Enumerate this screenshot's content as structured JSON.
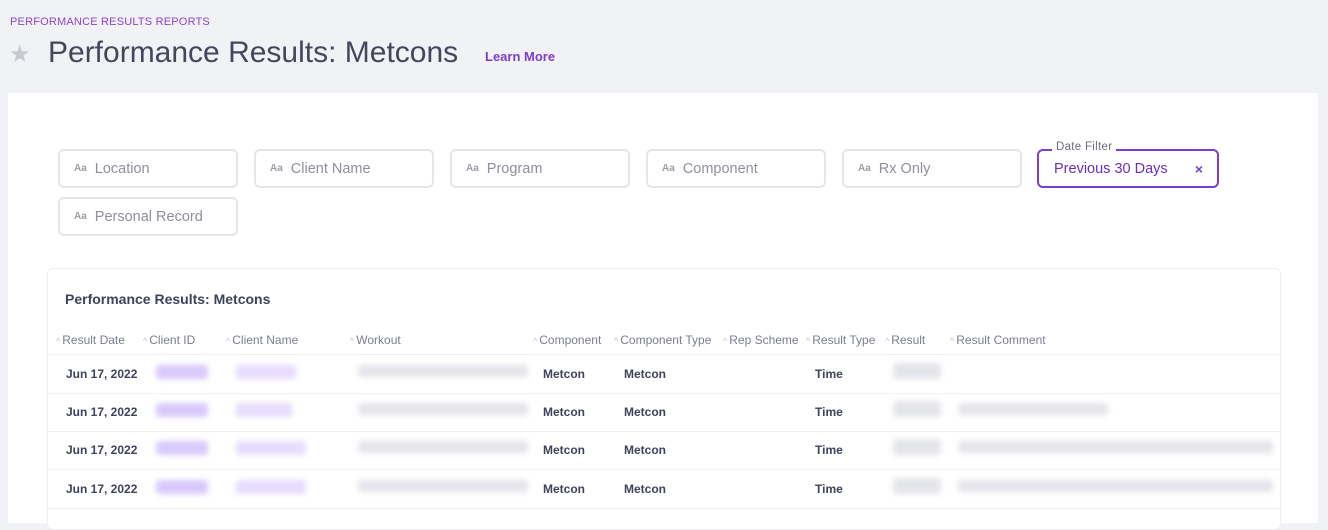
{
  "breadcrumb": "PERFORMANCE RESULTS REPORTS",
  "page_title": "Performance Results: Metcons",
  "learn_more": "Learn More",
  "filters": [
    {
      "icon_text": "Aa",
      "label": "Location"
    },
    {
      "icon_text": "Aa",
      "label": "Client Name"
    },
    {
      "icon_text": "Aa",
      "label": "Program"
    },
    {
      "icon_text": "Aa",
      "label": "Component"
    },
    {
      "icon_text": "Aa",
      "label": "Rx Only"
    },
    {
      "icon_text": "Aa",
      "label": "Personal Record"
    }
  ],
  "date_filter": {
    "label": "Date Filter",
    "value": "Previous 30 Days",
    "clear": "×"
  },
  "table": {
    "title": "Performance Results: Metcons",
    "columns": [
      "Result Date",
      "Client ID",
      "Client Name",
      "Workout",
      "Component",
      "Component Type",
      "Rep Scheme",
      "Result Type",
      "Result",
      "Result Comment"
    ],
    "rows": [
      {
        "date": "Jun 17, 2022",
        "component": "Metcon",
        "component_type": "Metcon",
        "result_type": "Time"
      },
      {
        "date": "Jun 17, 2022",
        "component": "Metcon",
        "component_type": "Metcon",
        "result_type": "Time"
      },
      {
        "date": "Jun 17, 2022",
        "component": "Metcon",
        "component_type": "Metcon",
        "result_type": "Time"
      },
      {
        "date": "Jun 17, 2022",
        "component": "Metcon",
        "component_type": "Metcon",
        "result_type": "Time"
      }
    ]
  },
  "colors": {
    "accent": "#7d3fc9",
    "background": "#f1f2f6",
    "text": "#3f4359"
  },
  "icons": {
    "favorite": "star-icon",
    "sort": "sort-caret-icon",
    "clear": "close-icon"
  }
}
